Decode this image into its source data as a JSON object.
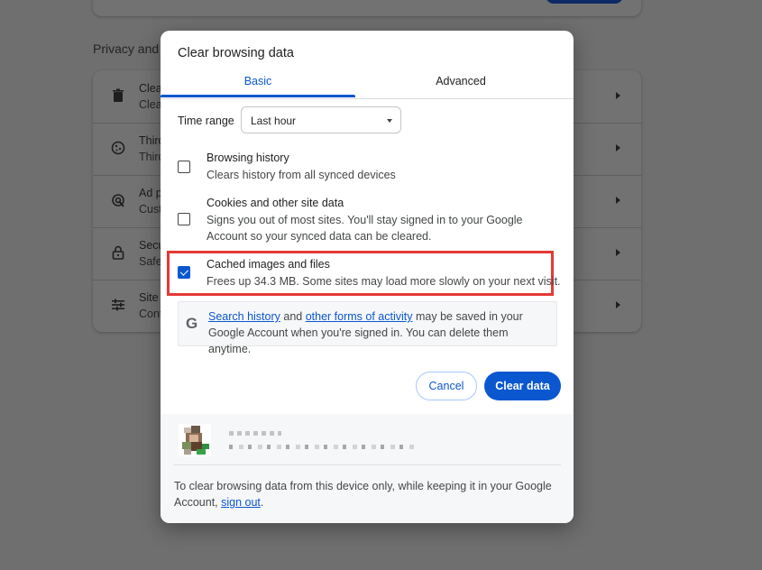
{
  "background": {
    "section_label": "Privacy and s",
    "rows": [
      {
        "icon": "trash-icon",
        "title": "Clea",
        "subtitle": "Clea"
      },
      {
        "icon": "cookie-icon",
        "title": "Third",
        "subtitle": "Third"
      },
      {
        "icon": "ad-icon",
        "title": "Ad p",
        "subtitle": "Cust"
      },
      {
        "icon": "lock-icon",
        "title": "Secu",
        "subtitle": "Safe"
      },
      {
        "icon": "sliders-icon",
        "title": "Site",
        "subtitle": "Cont"
      }
    ]
  },
  "dialog": {
    "title": "Clear browsing data",
    "tabs": [
      {
        "label": "Basic",
        "selected": true
      },
      {
        "label": "Advanced",
        "selected": false
      }
    ],
    "time_range": {
      "label": "Time range",
      "value": "Last hour"
    },
    "options": [
      {
        "title": "Browsing history",
        "description": "Clears history from all synced devices",
        "checked": false
      },
      {
        "title": "Cookies and other site data",
        "description": "Signs you out of most sites. You'll stay signed in to your Google Account so your synced data can be cleared.",
        "checked": false
      },
      {
        "title": "Cached images and files",
        "description": "Frees up 34.3 MB. Some sites may load more slowly on your next visit.",
        "checked": true
      }
    ],
    "info": {
      "link1": "Search history",
      "and": " and ",
      "link2": "other forms of activity",
      "rest": " may be saved in your Google Account when you're signed in. You can delete them anytime."
    },
    "buttons": {
      "cancel": "Cancel",
      "clear": "Clear data"
    },
    "footer": {
      "text": "To clear browsing data from this device only, while keeping it in your Google Account, ",
      "link": "sign out",
      "end": "."
    }
  },
  "colors": {
    "accent": "#0b57d0",
    "highlight": "#e53935",
    "overlay": "#6f6f6f"
  }
}
